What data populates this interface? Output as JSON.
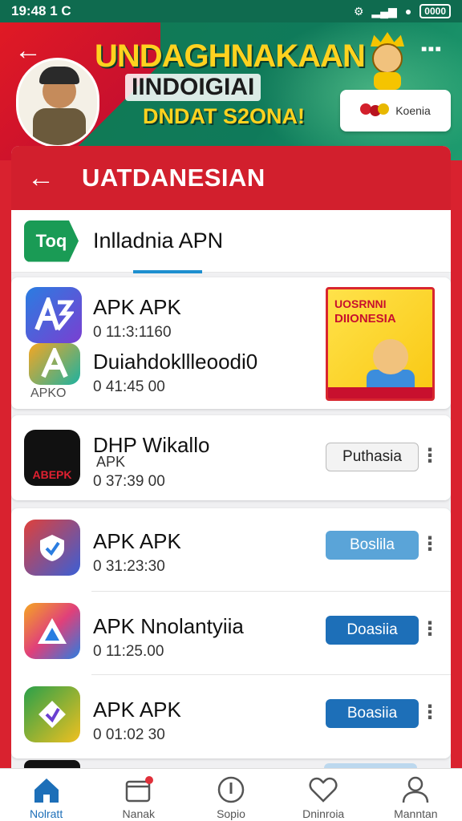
{
  "status_bar": {
    "time": "19:48 1 C",
    "battery": "0000"
  },
  "banner": {
    "title_line1": "UNDAGHNAKAAN",
    "title_line2": "IINDOIGIAI",
    "title_line3": "DNDAT S2ONA!",
    "partner_text": "Koenia"
  },
  "header": {
    "title": "UATDANESIAN"
  },
  "section": {
    "logo_text": "Toq",
    "title": "Inlladnia APN"
  },
  "featured": {
    "app1": {
      "name": "APK APK",
      "time": "0 11:3:1160"
    },
    "app2": {
      "name": "Duiahdokllleoodi0",
      "time": "0 41:45 00",
      "icon_label": "APKO"
    },
    "promo_line1": "UOSRNNI",
    "promo_line2": "DIIONESIA"
  },
  "list": [
    {
      "name": "DHP Wikallo",
      "sub": "APK",
      "time": "0 37:39 00",
      "button": "Puthasia",
      "icon_text": "ABEPK",
      "button_style": "light"
    },
    {
      "name": "APK APK",
      "sub": "",
      "time": "0 31:23:30",
      "button": "Boslila",
      "icon_text": "",
      "button_style": "blue-light"
    },
    {
      "name": "APK Nnolantyiia",
      "sub": "",
      "time": "0 11:25.00",
      "button": "Doasiia",
      "icon_text": "",
      "button_style": "blue"
    },
    {
      "name": "APK APK",
      "sub": "",
      "time": "0 01:02 30",
      "button": "Boasiia",
      "icon_text": "",
      "button_style": "blue"
    }
  ],
  "bottom_nav": [
    {
      "label": "Nolratt",
      "icon": "home-icon",
      "active": true
    },
    {
      "label": "Nanak",
      "icon": "inbox-icon",
      "active": false
    },
    {
      "label": "Sopio",
      "icon": "info-icon",
      "active": false
    },
    {
      "label": "Dninroia",
      "icon": "heart-icon",
      "active": false
    },
    {
      "label": "Manntan",
      "icon": "profile-icon",
      "active": false
    }
  ],
  "colors": {
    "brand_red": "#d21f2d",
    "brand_green": "#0f7a5a",
    "accent_blue": "#1d6fb8"
  }
}
